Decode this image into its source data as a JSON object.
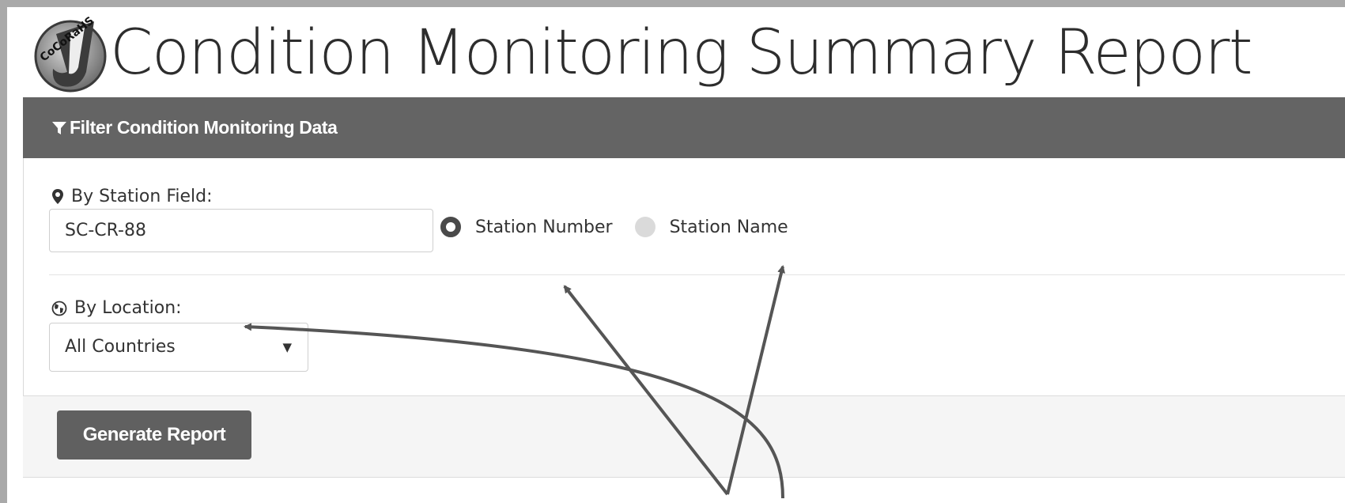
{
  "header": {
    "logo_text": "CoCoRaHS",
    "title": "Condition Monitoring Summary Report"
  },
  "filter_panel": {
    "heading": "Filter Condition Monitoring Data",
    "station_field": {
      "label": "By Station Field:",
      "value": "SC-CR-88",
      "radio_options": [
        {
          "label": "Station Number",
          "selected": true
        },
        {
          "label": "Station Name",
          "selected": false
        }
      ]
    },
    "location": {
      "label": "By Location:",
      "selected_option": "All Countries"
    },
    "generate_button_label": "Generate Report"
  },
  "icons": {
    "filter": "funnel-icon",
    "station": "map-pin-icon",
    "location": "globe-icon",
    "dropdown": "caret-down-icon"
  },
  "colors": {
    "panel_heading_bg": "#646464",
    "button_bg": "#606060",
    "annotation_arrow": "#555555"
  }
}
